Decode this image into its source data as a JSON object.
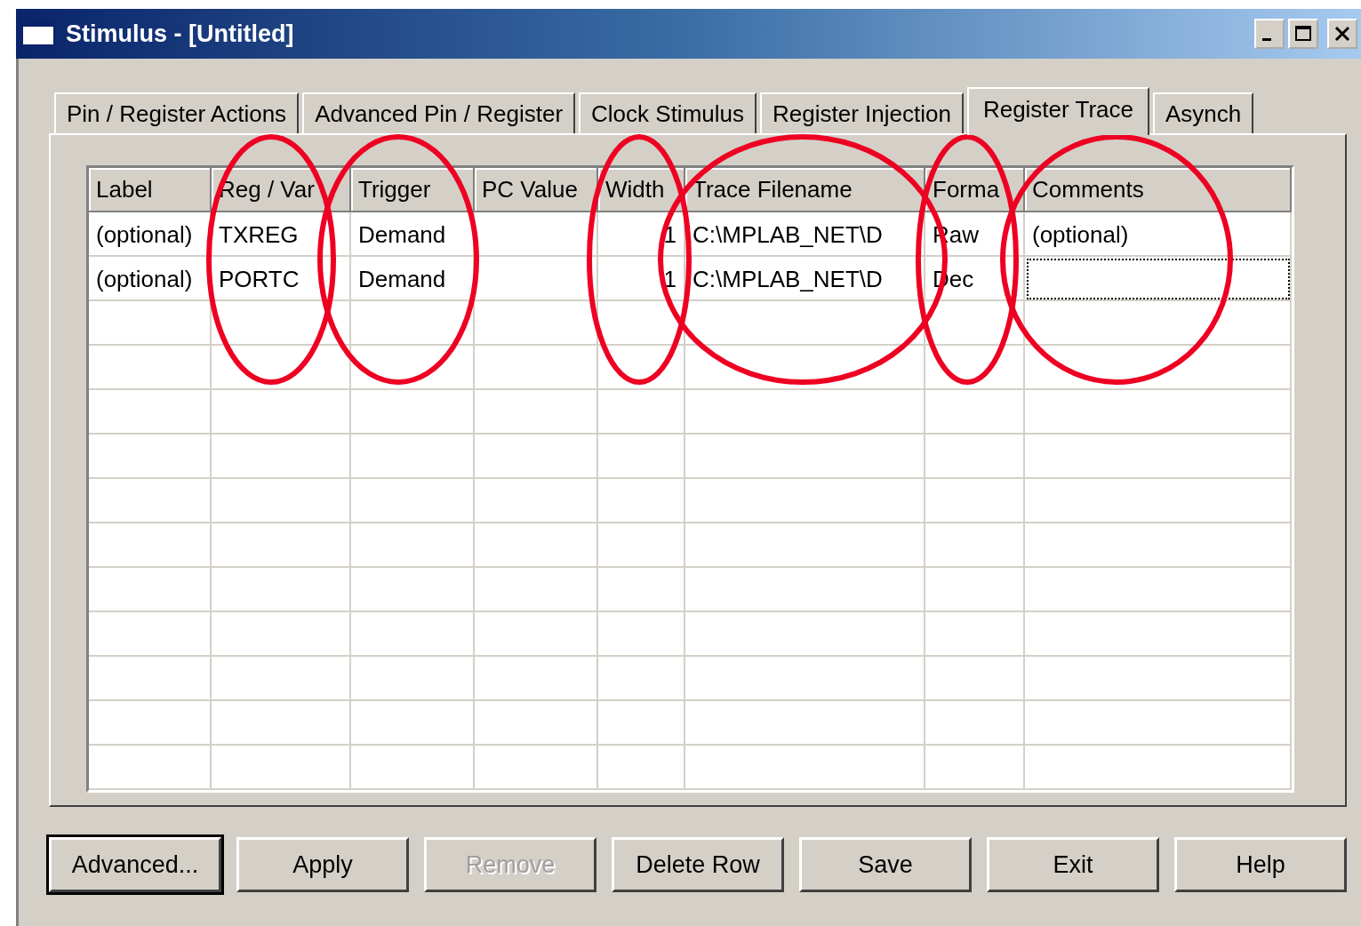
{
  "window": {
    "title": "Stimulus - [Untitled]"
  },
  "tabs": [
    {
      "label": "Pin / Register Actions",
      "selected": false
    },
    {
      "label": "Advanced Pin / Register",
      "selected": false
    },
    {
      "label": "Clock Stimulus",
      "selected": false
    },
    {
      "label": "Register Injection",
      "selected": false
    },
    {
      "label": "Register Trace",
      "selected": true
    },
    {
      "label": "Asynch",
      "selected": false
    }
  ],
  "table": {
    "columns": [
      "Label",
      "Reg / Var",
      "Trigger",
      "PC Value",
      "Width",
      "Trace Filename",
      "Forma",
      "Comments"
    ],
    "rows": [
      {
        "cells": [
          {
            "text": "(optional)",
            "focused": false
          },
          {
            "text": "TXREG",
            "focused": false
          },
          {
            "text": "Demand",
            "focused": false
          },
          {
            "text": "",
            "focused": false
          },
          {
            "text": "1",
            "focused": false
          },
          {
            "text": "C:\\MPLAB_NET\\D",
            "focused": false
          },
          {
            "text": "Raw",
            "focused": false
          },
          {
            "text": "(optional)",
            "focused": false
          }
        ]
      },
      {
        "cells": [
          {
            "text": "(optional)",
            "focused": false
          },
          {
            "text": "PORTC",
            "focused": false
          },
          {
            "text": "Demand",
            "focused": false
          },
          {
            "text": "",
            "focused": false
          },
          {
            "text": "1",
            "focused": false
          },
          {
            "text": "C:\\MPLAB_NET\\D",
            "focused": false
          },
          {
            "text": "Dec",
            "focused": false
          },
          {
            "text": "",
            "focused": true
          }
        ]
      }
    ]
  },
  "buttons": [
    {
      "label": "Advanced...",
      "disabled": false,
      "default": true
    },
    {
      "label": "Apply",
      "disabled": false,
      "default": false
    },
    {
      "label": "Remove",
      "disabled": true,
      "default": false
    },
    {
      "label": "Delete Row",
      "disabled": false,
      "default": false
    },
    {
      "label": "Save",
      "disabled": false,
      "default": false
    },
    {
      "label": "Exit",
      "disabled": false,
      "default": false
    },
    {
      "label": "Help",
      "disabled": false,
      "default": false
    }
  ]
}
